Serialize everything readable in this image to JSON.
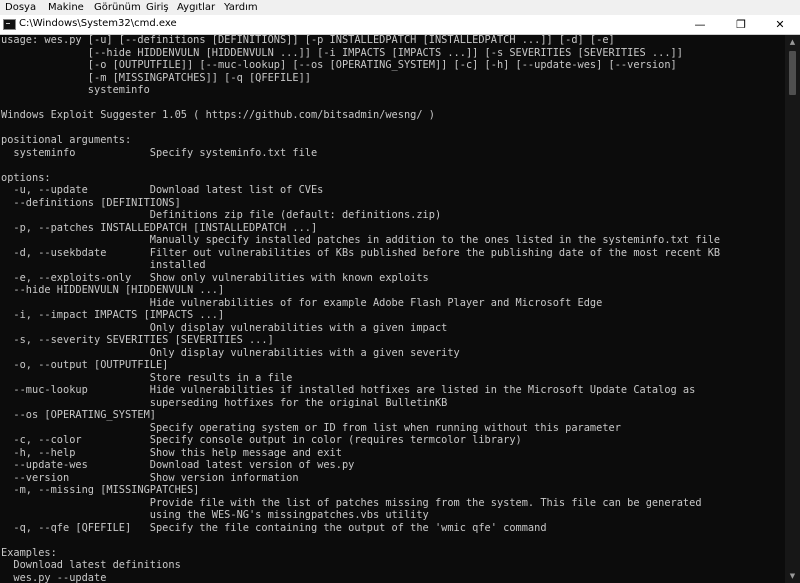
{
  "menu": [
    "Dosya",
    "Makine",
    "Görünüm",
    "Giriş",
    "Aygıtlar",
    "Yardım"
  ],
  "window": {
    "title": "C:\\Windows\\System32\\cmd.exe",
    "minimize": "—",
    "maximize": "❐",
    "close": "✕"
  },
  "icons": {
    "app": "cmd-console-icon",
    "scroll_up": "▲",
    "scroll_down": "▼"
  },
  "colors": {
    "console_bg": "#0c0c0c",
    "console_text": "#c8c8c8"
  },
  "console": {
    "lines": [
      "usage: wes.py [-u] [--definitions [DEFINITIONS]] [-p INSTALLEDPATCH [INSTALLEDPATCH ...]] [-d] [-e]",
      "              [--hide HIDDENVULN [HIDDENVULN ...]] [-i IMPACTS [IMPACTS ...]] [-s SEVERITIES [SEVERITIES ...]]",
      "              [-o [OUTPUTFILE]] [--muc-lookup] [--os [OPERATING_SYSTEM]] [-c] [-h] [--update-wes] [--version]",
      "              [-m [MISSINGPATCHES]] [-q [QFEFILE]]",
      "              systeminfo",
      "",
      "Windows Exploit Suggester 1.05 ( https://github.com/bitsadmin/wesng/ )",
      "",
      "positional arguments:",
      "  systeminfo            Specify systeminfo.txt file",
      "",
      "options:",
      "  -u, --update          Download latest list of CVEs",
      "  --definitions [DEFINITIONS]",
      "                        Definitions zip file (default: definitions.zip)",
      "  -p, --patches INSTALLEDPATCH [INSTALLEDPATCH ...]",
      "                        Manually specify installed patches in addition to the ones listed in the systeminfo.txt file",
      "  -d, --usekbdate       Filter out vulnerabilities of KBs published before the publishing date of the most recent KB",
      "                        installed",
      "  -e, --exploits-only   Show only vulnerabilities with known exploits",
      "  --hide HIDDENVULN [HIDDENVULN ...]",
      "                        Hide vulnerabilities of for example Adobe Flash Player and Microsoft Edge",
      "  -i, --impact IMPACTS [IMPACTS ...]",
      "                        Only display vulnerabilities with a given impact",
      "  -s, --severity SEVERITIES [SEVERITIES ...]",
      "                        Only display vulnerabilities with a given severity",
      "  -o, --output [OUTPUTFILE]",
      "                        Store results in a file",
      "  --muc-lookup          Hide vulnerabilities if installed hotfixes are listed in the Microsoft Update Catalog as",
      "                        superseding hotfixes for the original BulletinKB",
      "  --os [OPERATING_SYSTEM]",
      "                        Specify operating system or ID from list when running without this parameter",
      "  -c, --color           Specify console output in color (requires termcolor library)",
      "  -h, --help            Show this help message and exit",
      "  --update-wes          Download latest version of wes.py",
      "  --version             Show version information",
      "  -m, --missing [MISSINGPATCHES]",
      "                        Provide file with the list of patches missing from the system. This file can be generated",
      "                        using the WES-NG's missingpatches.vbs utility",
      "  -q, --qfe [QFEFILE]   Specify the file containing the output of the 'wmic qfe' command",
      "",
      "Examples:",
      "  Download latest definitions",
      "  wes.py --update"
    ]
  }
}
